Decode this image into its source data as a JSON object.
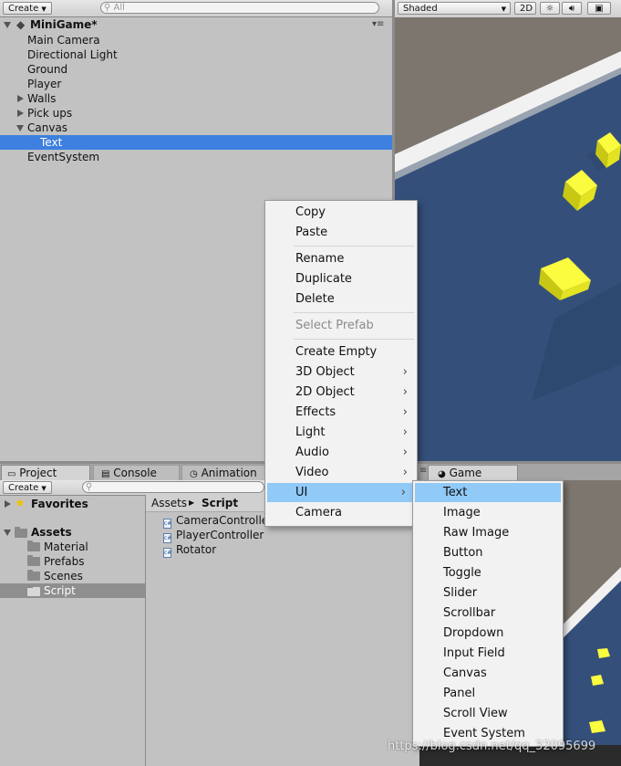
{
  "hierarchy": {
    "create_label": "Create",
    "search_placeholder": "All",
    "scene_name": "MiniGame*",
    "items": [
      {
        "label": "Main Camera"
      },
      {
        "label": "Directional Light"
      },
      {
        "label": "Ground"
      },
      {
        "label": "Player"
      },
      {
        "label": "Walls"
      },
      {
        "label": "Pick ups"
      },
      {
        "label": "Canvas"
      },
      {
        "label": "Text"
      },
      {
        "label": "EventSystem"
      }
    ]
  },
  "scene_view": {
    "shading_mode": "Shaded",
    "mode_2d": "2D"
  },
  "context_menu": {
    "items": [
      {
        "label": "Copy"
      },
      {
        "label": "Paste"
      },
      {
        "label": "Rename"
      },
      {
        "label": "Duplicate"
      },
      {
        "label": "Delete"
      },
      {
        "label": "Select Prefab"
      },
      {
        "label": "Create Empty"
      },
      {
        "label": "3D Object"
      },
      {
        "label": "2D Object"
      },
      {
        "label": "Effects"
      },
      {
        "label": "Light"
      },
      {
        "label": "Audio"
      },
      {
        "label": "Video"
      },
      {
        "label": "UI"
      },
      {
        "label": "Camera"
      }
    ]
  },
  "ui_submenu": {
    "items": [
      {
        "label": "Text"
      },
      {
        "label": "Image"
      },
      {
        "label": "Raw Image"
      },
      {
        "label": "Button"
      },
      {
        "label": "Toggle"
      },
      {
        "label": "Slider"
      },
      {
        "label": "Scrollbar"
      },
      {
        "label": "Dropdown"
      },
      {
        "label": "Input Field"
      },
      {
        "label": "Canvas"
      },
      {
        "label": "Panel"
      },
      {
        "label": "Scroll View"
      },
      {
        "label": "Event System"
      }
    ]
  },
  "project": {
    "tabs": [
      {
        "label": "Project"
      },
      {
        "label": "Console"
      },
      {
        "label": "Animation"
      }
    ],
    "create_label": "Create",
    "favorites_label": "Favorites",
    "assets_label": "Assets",
    "folders": [
      {
        "label": "Material"
      },
      {
        "label": "Prefabs"
      },
      {
        "label": "Scenes"
      },
      {
        "label": "Script"
      }
    ],
    "breadcrumb": [
      "Assets",
      "Script"
    ],
    "files": [
      {
        "label": "CameraControlle"
      },
      {
        "label": "PlayerController"
      },
      {
        "label": "Rotator"
      }
    ]
  },
  "game_view": {
    "tab_label": "Game"
  },
  "watermark": "https://blog.csdn.net/qq_32095699",
  "colors": {
    "selection": "#3d80df",
    "menu_highlight": "#91c9f7",
    "scene_floor": "#34507a"
  }
}
